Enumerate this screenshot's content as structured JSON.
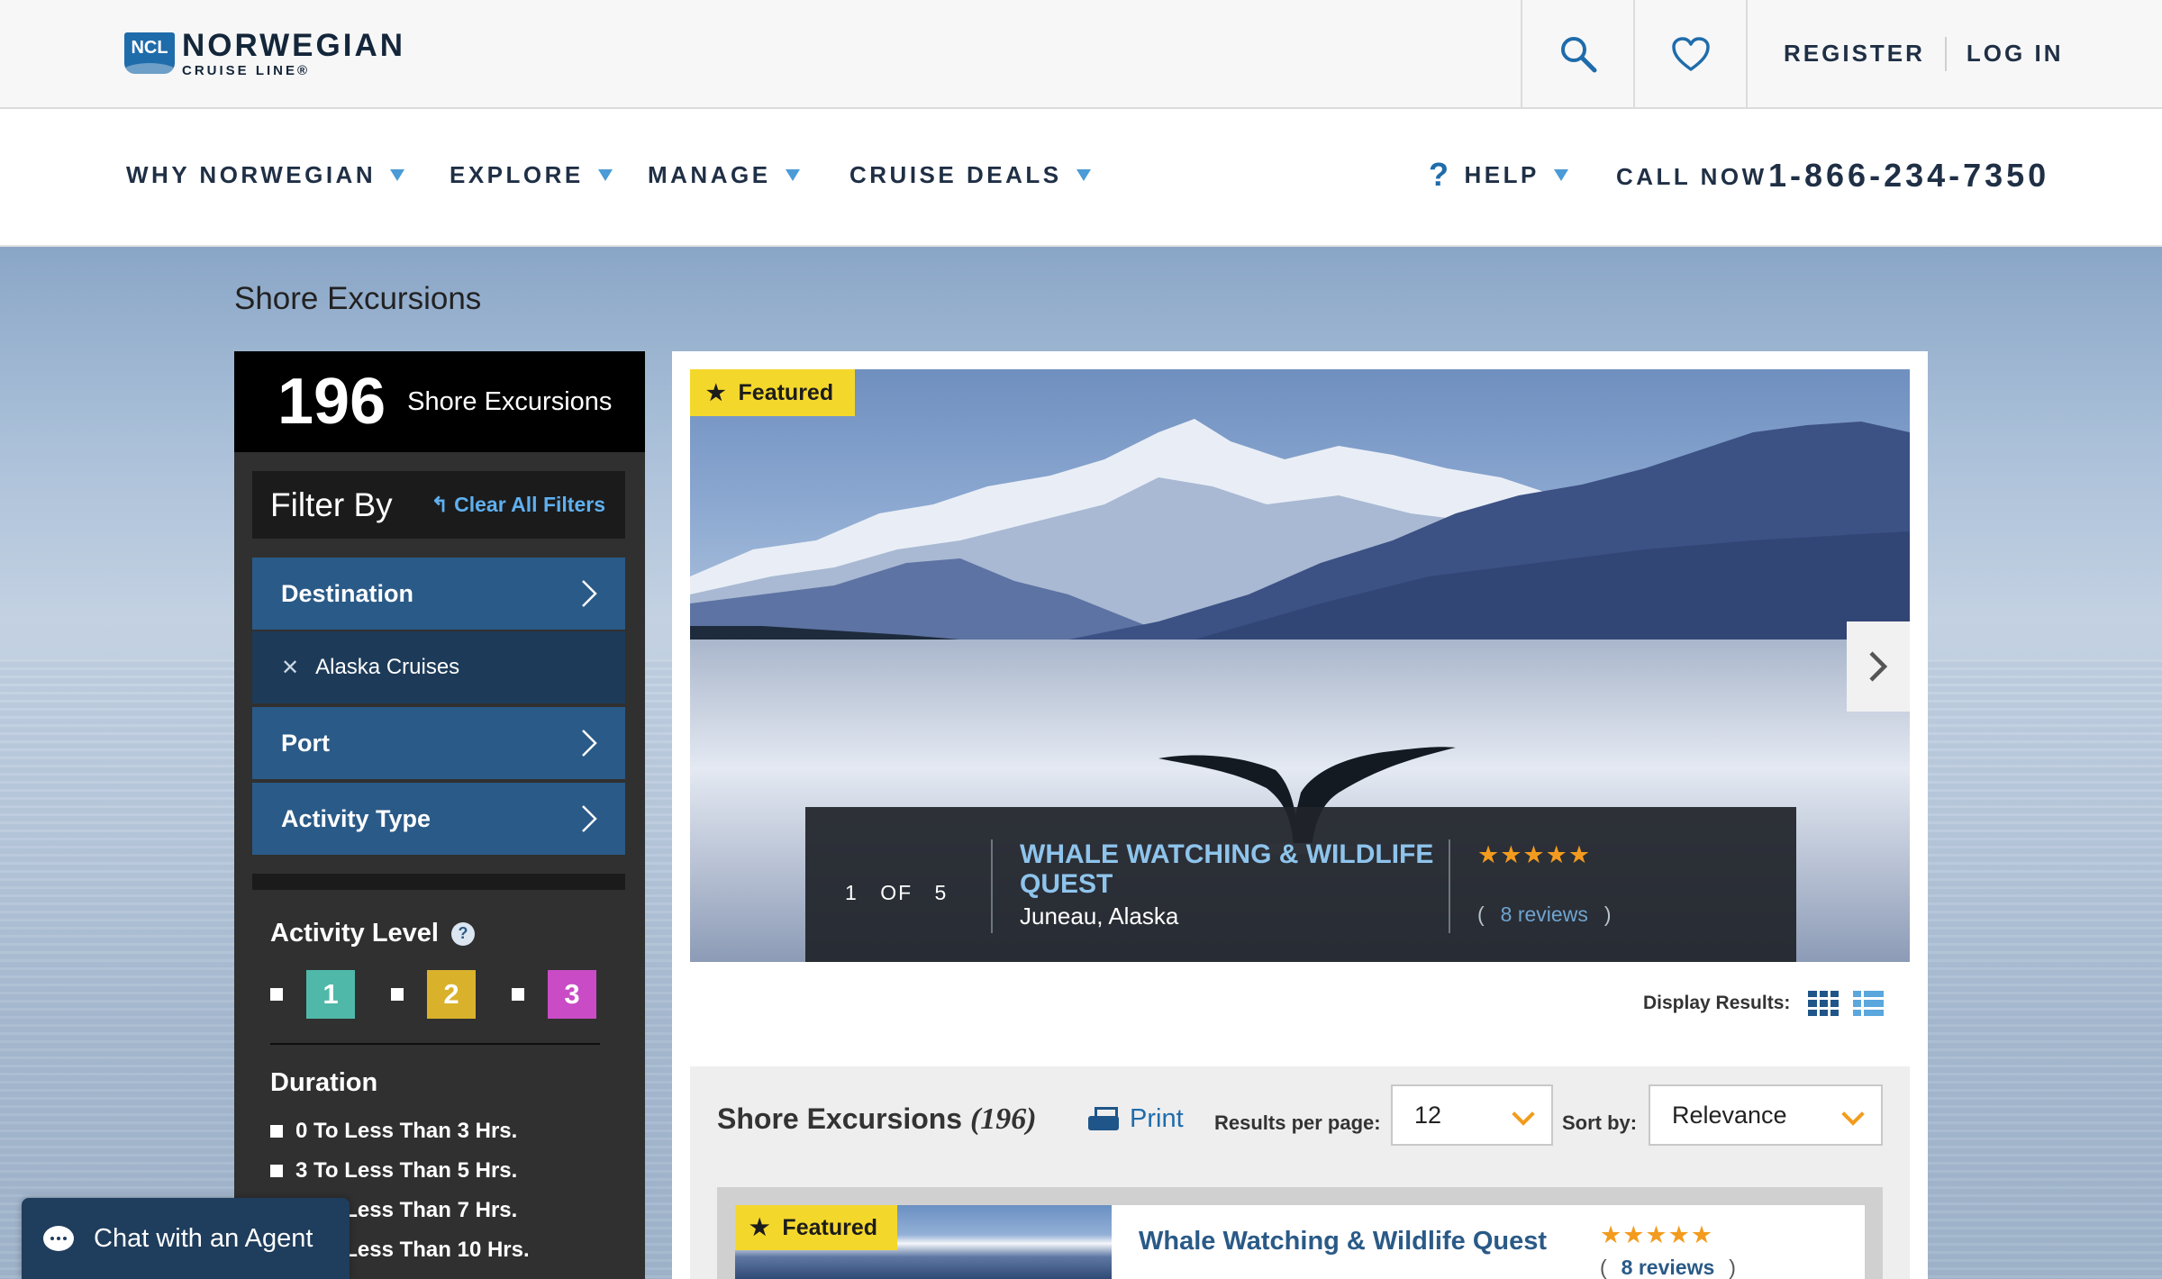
{
  "header": {
    "logo_badge": "NCL",
    "logo_main": "NORWEGIAN",
    "logo_sub": "CRUISE LINE®",
    "register": "REGISTER",
    "login": "LOG IN"
  },
  "nav": {
    "items": [
      "WHY NORWEGIAN",
      "EXPLORE",
      "MANAGE",
      "CRUISE DEALS"
    ],
    "help": "HELP",
    "help_icon": "?",
    "call_label": "CALL NOW",
    "phone": "1-866-234-7350"
  },
  "page": {
    "title": "Shore Excursions"
  },
  "sidebar": {
    "count": "196",
    "count_label": "Shore Excursions",
    "filter_title": "Filter By",
    "clear_all": "↰ Clear All Filters",
    "facets": {
      "destination": "Destination",
      "destination_selected": "Alaska Cruises",
      "port": "Port",
      "activity_type": "Activity Type"
    },
    "activity_level": {
      "title": "Activity Level",
      "help": "?",
      "levels": [
        {
          "label": "1",
          "color": "#4fb8a9"
        },
        {
          "label": "2",
          "color": "#d9b12b"
        },
        {
          "label": "3",
          "color": "#c94bc5"
        }
      ]
    },
    "duration": {
      "title": "Duration",
      "options": [
        "0 To Less Than 3 Hrs.",
        "3 To Less Than 5 Hrs.",
        "5 To Less Than 7 Hrs.",
        "7 To Less Than 10 Hrs."
      ]
    }
  },
  "chat": {
    "label": "Chat with an Agent"
  },
  "hero": {
    "featured": "Featured",
    "index": "1",
    "of": "OF",
    "total": "5",
    "title": "WHALE WATCHING & WILDLIFE QUEST",
    "location": "Juneau, Alaska",
    "stars": "★★★★★",
    "reviews": "8 reviews",
    "paren_open": "(",
    "paren_close": ")"
  },
  "results": {
    "display_label": "Display Results:",
    "title": "Shore Excursions",
    "count": "(196)",
    "print": "Print",
    "per_page_label": "Results per page:",
    "per_page_value": "12",
    "sort_label": "Sort by:",
    "sort_value": "Relevance"
  },
  "card": {
    "featured": "Featured",
    "title": "Whale Watching & Wildlife Quest",
    "stars": "★★★★★",
    "reviews": "8 reviews",
    "paren_open": "(",
    "paren_close": ")"
  },
  "colors": {
    "brand_blue": "#1f6cab",
    "facet_blue": "#2a5a87",
    "star_orange": "#f39b1e",
    "featured_yellow": "#f4d72b"
  }
}
